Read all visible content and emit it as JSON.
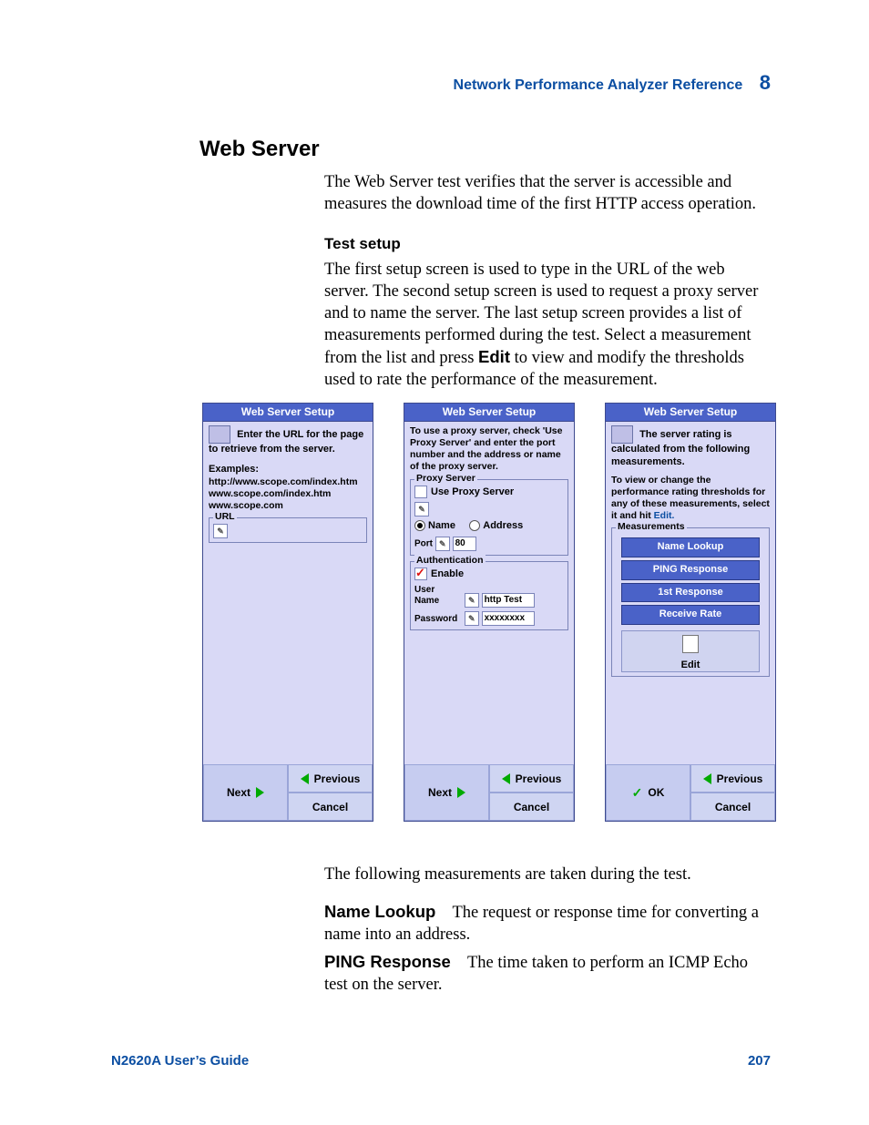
{
  "running_header": {
    "title": "Network Performance Analyzer Reference",
    "chapter": "8"
  },
  "section_heading": "Web Server",
  "intro": "The Web Server test verifies that the server is accessible and measures the download time of the first HTTP access operation.",
  "test_setup": {
    "heading": "Test setup",
    "para_a": "The first setup screen is used to type in the URL of the web server. The second setup screen is used to request a proxy server and to name the server. The last setup screen provides a list of measurements performed during the test. Select a measurement from the list and press ",
    "para_edit": "Edit",
    "para_b": " to view and modify the thresholds used to rate the performance of the measurement."
  },
  "dialogs": {
    "title": "Web Server Setup",
    "buttons": {
      "previous": "Previous",
      "next": "Next",
      "cancel": "Cancel",
      "ok": "OK"
    },
    "d1": {
      "hint": "Enter the URL for the page to retrieve from the server.",
      "examples_label": "Examples:",
      "examples": [
        "http://www.scope.com/index.htm",
        "www.scope.com/index.htm",
        "www.scope.com"
      ],
      "url_group": "URL"
    },
    "d2": {
      "hint": "To use a proxy server, check 'Use Proxy Server' and enter the port number and the address or name of the proxy server.",
      "proxy_group": "Proxy Server",
      "use_proxy": "Use Proxy Server",
      "name": "Name",
      "address": "Address",
      "port_label": "Port",
      "port_value": "80",
      "auth_group": "Authentication",
      "enable": "Enable",
      "user_label": "User Name",
      "user_value": "http Test",
      "pass_label": "Password",
      "pass_value": "xxxxxxxx"
    },
    "d3": {
      "hint": "The server rating is calculated from the following measurements.",
      "instr_a": "To view or change the performance rating thresholds for any of these measurements, select it and hit ",
      "instr_edit": "Edit.",
      "meas_group": "Measurements",
      "items": [
        "Name Lookup",
        "PING Response",
        "1st Response",
        "Receive Rate"
      ],
      "edit": "Edit"
    }
  },
  "after_shots": "The following measurements are taken during the test.",
  "meas_defs": {
    "name_lookup": {
      "term": "Name Lookup",
      "def": "The request or response time for converting a name into an address."
    },
    "ping_response": {
      "term": "PING Response",
      "def": "The time taken to perform an ICMP Echo test on the server."
    }
  },
  "footer": {
    "left": "N2620A User’s Guide",
    "right": "207"
  }
}
